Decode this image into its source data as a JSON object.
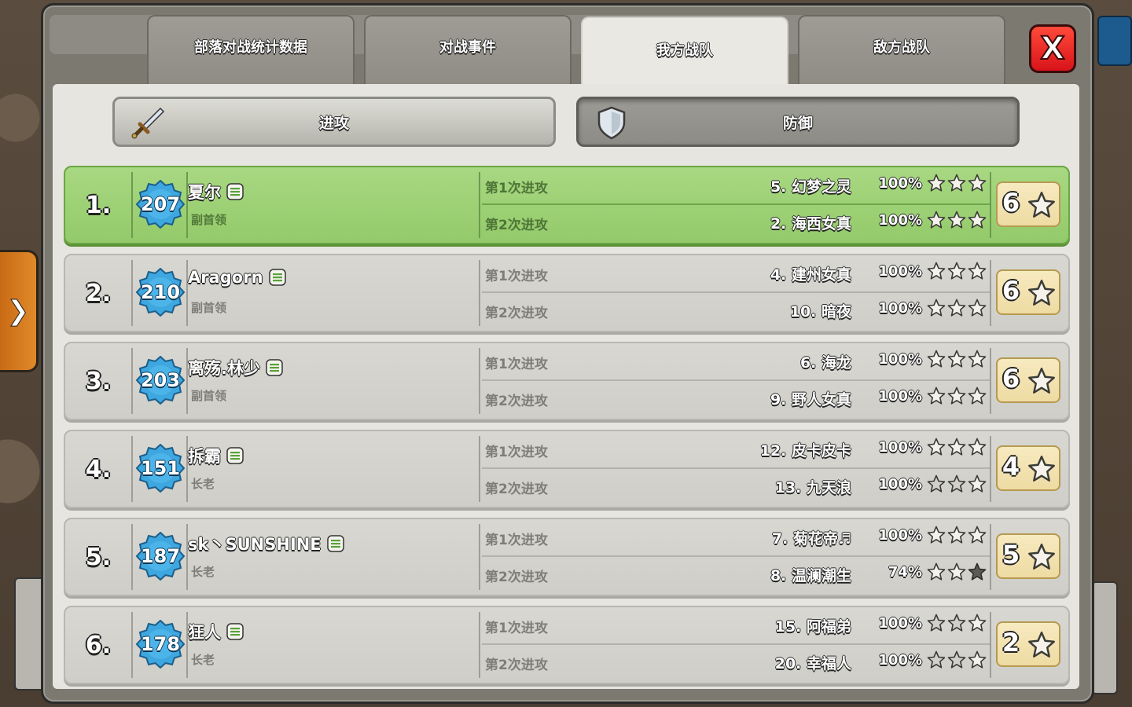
{
  "tabs": [
    {
      "label": "部落对战统计数据",
      "active": false
    },
    {
      "label": "对战事件",
      "active": false
    },
    {
      "label": "我方战队",
      "active": true
    },
    {
      "label": "敌方战队",
      "active": false
    }
  ],
  "close_label": "X",
  "side_tab_label": "❯",
  "sub_buttons": {
    "attack": "进攻",
    "defense": "防御",
    "selected": "attack"
  },
  "members": [
    {
      "rank": "1.",
      "level": "207",
      "name": "夏尔",
      "role": "副首领",
      "highlight": true,
      "total": "6",
      "attacks": [
        {
          "label": "第1次进攻",
          "target": "5. 幻梦之灵",
          "percent": "100%",
          "stars": [
            1,
            1,
            1
          ]
        },
        {
          "label": "第2次进攻",
          "target": "2. 海西女真",
          "percent": "100%",
          "stars": [
            1,
            1,
            1
          ]
        }
      ]
    },
    {
      "rank": "2.",
      "level": "210",
      "name": "Aragorn",
      "role": "副首领",
      "highlight": false,
      "total": "6",
      "attacks": [
        {
          "label": "第1次进攻",
          "target": "4. 建州女真",
          "percent": "100%",
          "stars": [
            1,
            1,
            1
          ]
        },
        {
          "label": "第2次进攻",
          "target": "10. 暗夜",
          "percent": "100%",
          "stars": [
            1,
            1,
            1
          ]
        }
      ]
    },
    {
      "rank": "3.",
      "level": "203",
      "name": "离殇.林少",
      "role": "副首领",
      "highlight": false,
      "total": "6",
      "attacks": [
        {
          "label": "第1次进攻",
          "target": "6. 海龙",
          "percent": "100%",
          "stars": [
            1,
            1,
            1
          ]
        },
        {
          "label": "第2次进攻",
          "target": "9. 野人女真",
          "percent": "100%",
          "stars": [
            1,
            1,
            1
          ]
        }
      ]
    },
    {
      "rank": "4.",
      "level": "151",
      "name": "拆霸",
      "role": "长老",
      "highlight": false,
      "total": "4",
      "attacks": [
        {
          "label": "第1次进攻",
          "target": "12. 皮卡皮卡",
          "percent": "100%",
          "stars": [
            1,
            1,
            1
          ]
        },
        {
          "label": "第2次进攻",
          "target": "13. 九天浪",
          "percent": "100%",
          "stars": [
            0,
            0,
            1
          ]
        }
      ]
    },
    {
      "rank": "5.",
      "level": "187",
      "name": "sk丶SUNSHINE",
      "role": "长老",
      "highlight": false,
      "total": "5",
      "attacks": [
        {
          "label": "第1次进攻",
          "target": "7. 菊花帝♬",
          "percent": "100%",
          "stars": [
            1,
            1,
            1
          ]
        },
        {
          "label": "第2次进攻",
          "target": "8. 温澜潮生",
          "percent": "74%",
          "stars": [
            1,
            1,
            2
          ]
        }
      ]
    },
    {
      "rank": "6.",
      "level": "178",
      "name": "狂人",
      "role": "长老",
      "highlight": false,
      "total": "2",
      "attacks": [
        {
          "label": "第1次进攻",
          "target": "15. 阿福弟",
          "percent": "100%",
          "stars": [
            0,
            0,
            1
          ]
        },
        {
          "label": "第2次进攻",
          "target": "20. 幸福人",
          "percent": "100%",
          "stars": [
            0,
            0,
            1
          ]
        }
      ]
    }
  ],
  "icons": {
    "attack": "sword-icon",
    "defense": "shield-icon",
    "level": "xp-star-badge-icon",
    "chat": "chat-icon",
    "star": "star-icon",
    "close": "close-icon"
  },
  "colors": {
    "highlight_row": "#9fd27a",
    "row": "#d6d5cf",
    "close": "#e0221f",
    "badge_blue": "#3ea7e0",
    "star_gold": "#f3f1e6",
    "total_bg": "#f3e3b0"
  }
}
